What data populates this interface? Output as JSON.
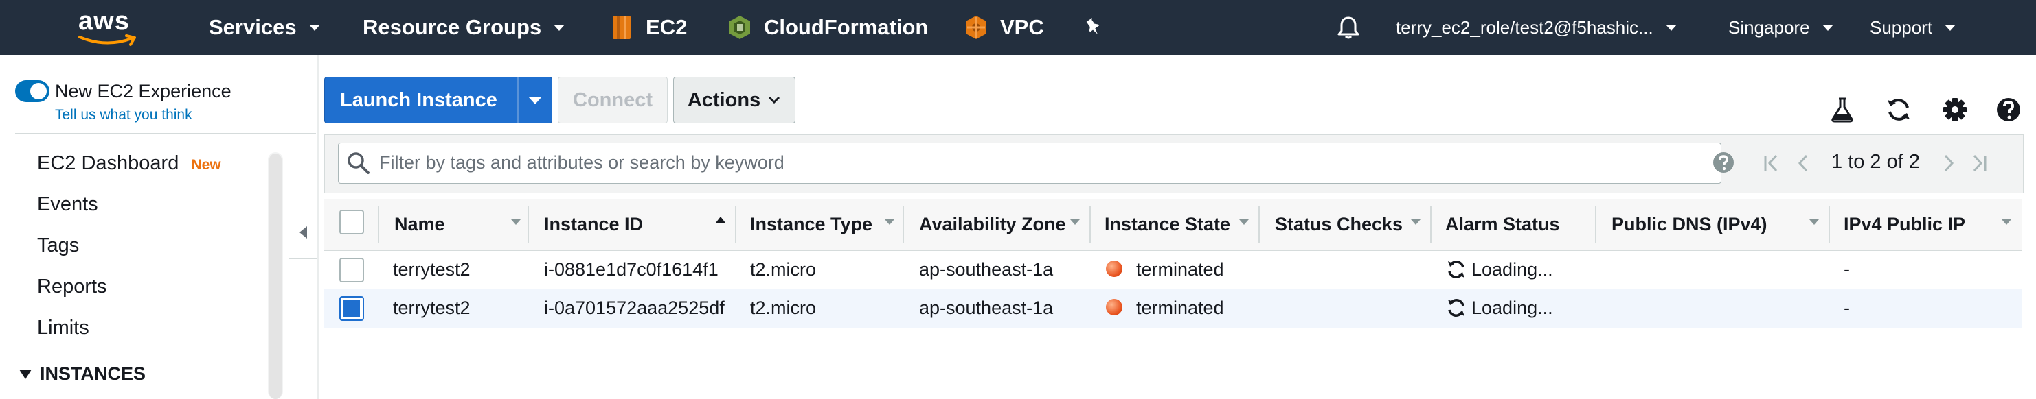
{
  "nav": {
    "logo_text": "aws",
    "services_label": "Services",
    "resource_groups_label": "Resource Groups",
    "pins": [
      {
        "label": "EC2",
        "icon": "ec2-icon",
        "color": "#e47911"
      },
      {
        "label": "CloudFormation",
        "icon": "cloudformation-icon",
        "color": "#759c3e"
      },
      {
        "label": "VPC",
        "icon": "vpc-icon",
        "color": "#e47911"
      }
    ],
    "account_label": "terry_ec2_role/test2@f5hashic...",
    "region_label": "Singapore",
    "support_label": "Support"
  },
  "sidebar": {
    "new_experience_label": "New EC2 Experience",
    "feedback_link": "Tell us what you think",
    "items": [
      {
        "label": "EC2 Dashboard",
        "badge": "New"
      },
      {
        "label": "Events"
      },
      {
        "label": "Tags"
      },
      {
        "label": "Reports"
      },
      {
        "label": "Limits"
      }
    ],
    "section_label": "INSTANCES"
  },
  "toolbar": {
    "launch_label": "Launch Instance",
    "connect_label": "Connect",
    "actions_label": "Actions"
  },
  "filter": {
    "placeholder": "Filter by tags and attributes or search by keyword",
    "pagination": "1 to 2 of 2"
  },
  "table": {
    "columns": [
      "Name",
      "Instance ID",
      "Instance Type",
      "Availability Zone",
      "Instance State",
      "Status Checks",
      "Alarm Status",
      "Public DNS (IPv4)",
      "IPv4 Public IP"
    ],
    "rows": [
      {
        "selected": false,
        "name": "terrytest2",
        "instance_id": "i-0881e1d7c0f1614f1",
        "type": "t2.micro",
        "az": "ap-southeast-1a",
        "state": "terminated",
        "status_checks": "",
        "alarm": "Loading...",
        "dns": "",
        "ip": "-"
      },
      {
        "selected": true,
        "name": "terrytest2",
        "instance_id": "i-0a701572aaa2525df",
        "type": "t2.micro",
        "az": "ap-southeast-1a",
        "state": "terminated",
        "status_checks": "",
        "alarm": "Loading...",
        "dns": "",
        "ip": "-"
      }
    ]
  },
  "colors": {
    "nav_bg": "#232f3e",
    "primary_button": "#1f6fcf",
    "terminated_status": "#e8531f",
    "accent_orange": "#ec7211"
  }
}
